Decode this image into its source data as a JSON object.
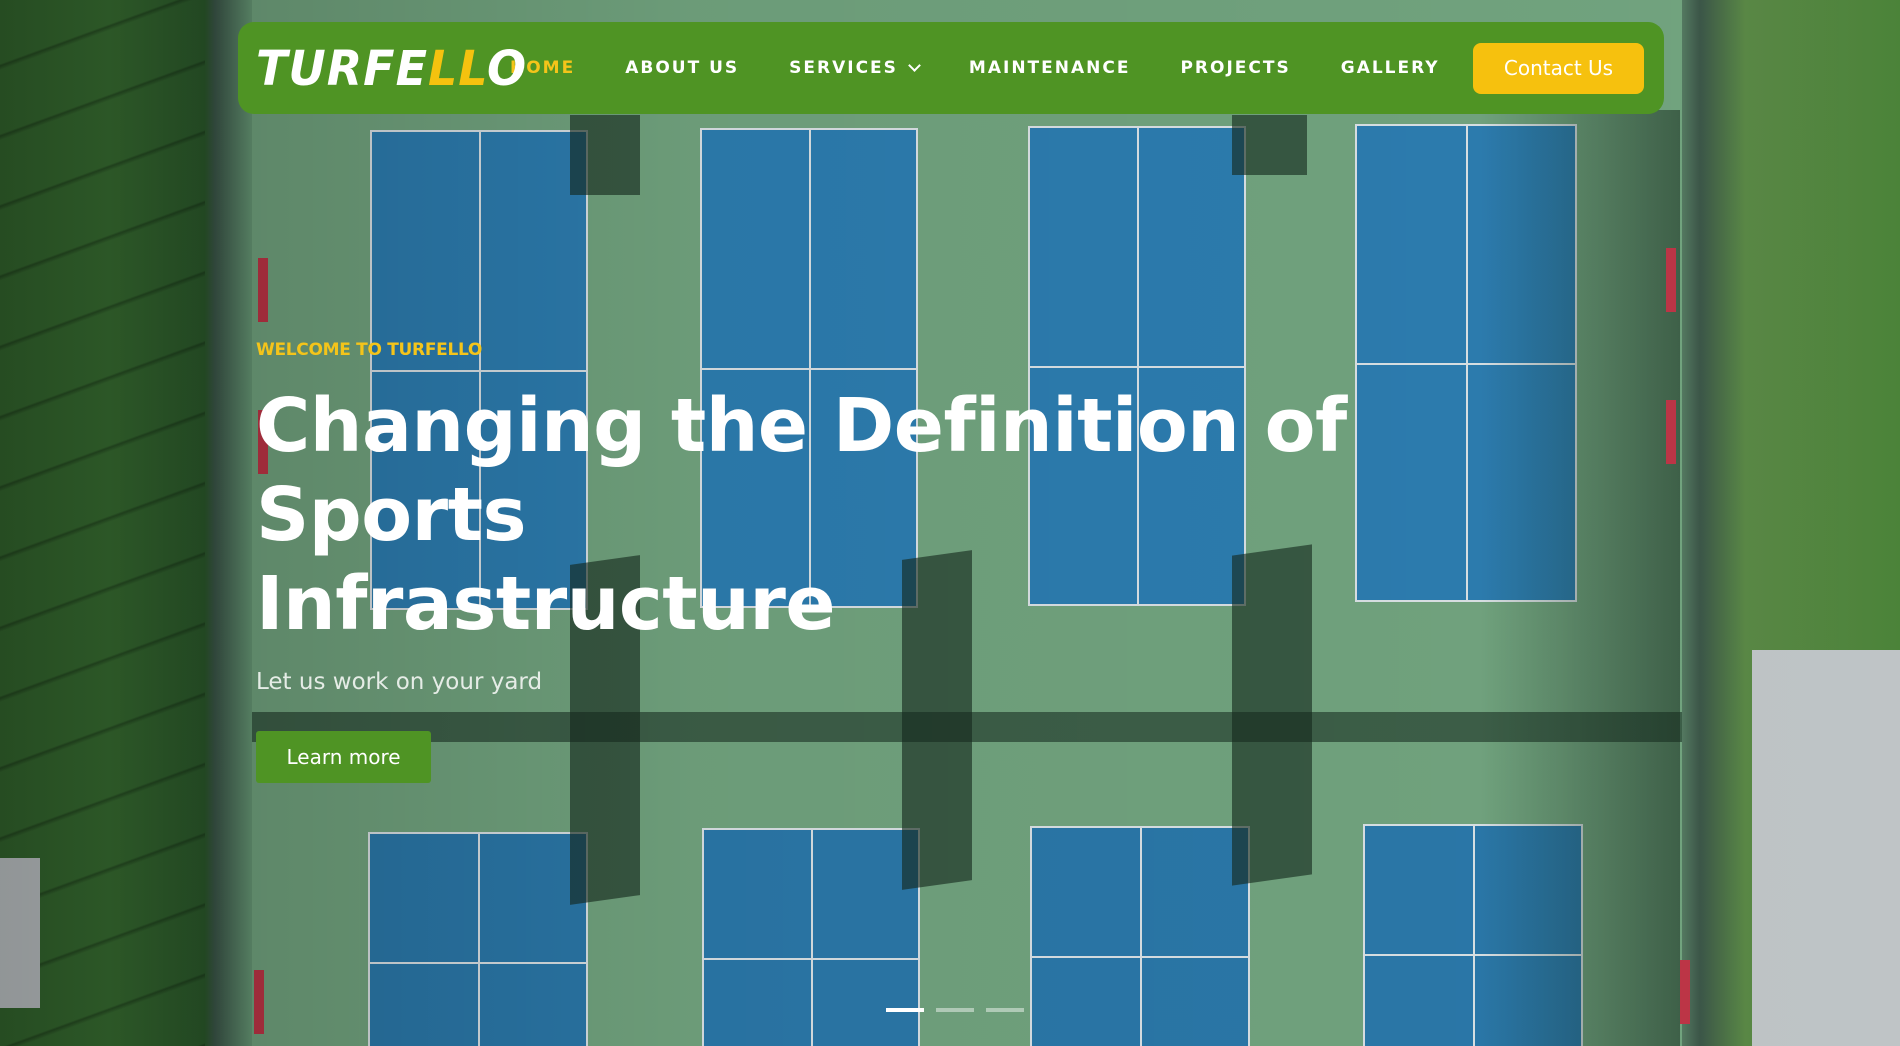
{
  "navbar": {
    "logo_main": "TURFE",
    "logo_accent": "LL",
    "logo_end": "O",
    "links": [
      {
        "label": "HOME",
        "active": true
      },
      {
        "label": "ABOUT US",
        "active": false
      },
      {
        "label": "SERVICES",
        "active": false,
        "has_dropdown": true
      },
      {
        "label": "MAINTENANCE",
        "active": false
      },
      {
        "label": "PROJECTS",
        "active": false
      },
      {
        "label": "GALLERY",
        "active": false
      }
    ],
    "contact_label": "Contact Us"
  },
  "hero": {
    "eyebrow": "WELCOME TO TURFELLO",
    "headline_line1": "Changing the Definition of Sports",
    "headline_line2": "Infrastructure",
    "subline": "Let us work on your yard",
    "cta_label": "Learn more"
  },
  "slider": {
    "slide_count": 3,
    "active_index": 0
  },
  "colors": {
    "brand_green": "#4f9424",
    "accent_yellow": "#f6c10e",
    "court_blue": "#2d7fb3",
    "court_green": "#78ad86"
  },
  "icons": {
    "dropdown": "chevron-down-icon"
  }
}
